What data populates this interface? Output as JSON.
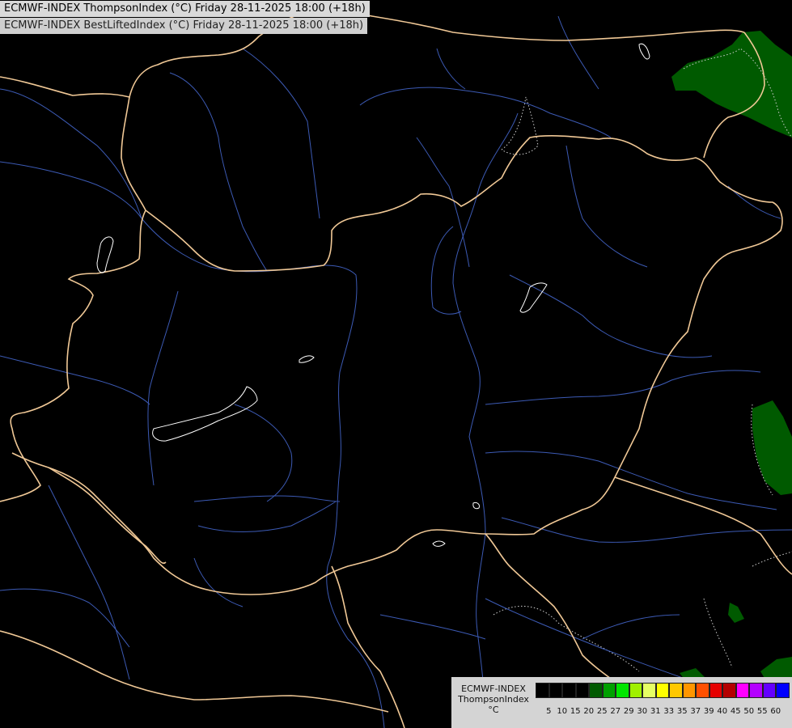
{
  "title": {
    "line1": "ECMWF-INDEX ThompsonIndex (°C) Friday 28-11-2025 18:00 (+18h)",
    "line2": "ECMWF-INDEX BestLiftedIndex (°C) Friday 28-11-2025 18:00 (+18h)"
  },
  "legend": {
    "model": "ECMWF-INDEX",
    "parameter": "ThompsonIndex",
    "unit": "°C",
    "ticks": [
      "5",
      "10",
      "15",
      "20",
      "25",
      "27",
      "29",
      "30",
      "31",
      "33",
      "35",
      "37",
      "39",
      "40",
      "45",
      "50",
      "55",
      "60"
    ],
    "colors": [
      "#000000",
      "#000000",
      "#000000",
      "#000000",
      "#005a00",
      "#00a000",
      "#00e600",
      "#a0f000",
      "#e6ff64",
      "#ffff00",
      "#ffc800",
      "#ff9600",
      "#ff5000",
      "#e60000",
      "#b40000",
      "#ff00ff",
      "#b400ff",
      "#6400ff",
      "#0000ff"
    ]
  },
  "map": {
    "background_color": "#000000",
    "border_color": "#f0c896",
    "river_color": "#3c5ab4",
    "lake_color": "#ffffff",
    "field_colors": {
      "dark_green": "#005a00"
    }
  }
}
